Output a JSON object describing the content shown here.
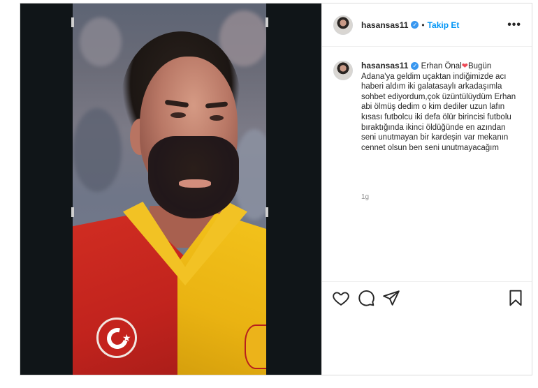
{
  "post": {
    "username": "hasansas11",
    "verified_mark": "✓",
    "separator": "•",
    "follow_label": "Takip Et",
    "more_label": "•••",
    "caption": {
      "username": "hasansas11",
      "heart": "❤",
      "text_part1": " Erhan Önal",
      "text_part2": "Bugün Adana'ya geldim uçaktan indiğimizde acı haberi aldım iki galatasaylı arkadaşımla sohbet ediyordum,çok üzüntülüydüm Erhan abi ölmüş dedim o kim dediler uzun lafın kısası futbolcu iki defa ölür birincisi futbolu bıraktığında ikinci öldüğünde en azından seni unutmayan bir kardeşin var mekanın cennet olsun ben seni unutmayacağım"
    },
    "time": "1g"
  },
  "icons": {
    "like": "heart-icon",
    "comment": "comment-icon",
    "share": "send-icon",
    "save": "bookmark-icon"
  },
  "colors": {
    "link_blue": "#0095f6",
    "verified_blue": "#3897f0",
    "heart_red": "#ed4956"
  }
}
